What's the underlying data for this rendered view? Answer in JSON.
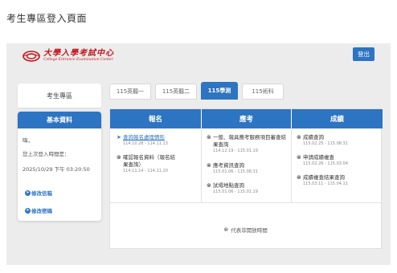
{
  "page": {
    "title": "考生專區登入頁面"
  },
  "header": {
    "logo_main": "大學入學考試中心",
    "logo_sub": "College Entrance Examination Center",
    "logout_label": "登出"
  },
  "sidebar": {
    "heading": "考生專區",
    "card_title": "基本資料",
    "greeting": "嗨，",
    "last_login_label": "您上次登入時間是：",
    "last_login_value": "2025/10/29 下午 03:20:50",
    "links": [
      {
        "label": "修改信箱",
        "icon": "arrow-circle-right-icon"
      },
      {
        "label": "修改密碼",
        "icon": "arrow-circle-right-icon"
      }
    ]
  },
  "tabs": [
    {
      "label": "115英聽一",
      "active": false
    },
    {
      "label": "115英聽二",
      "active": false
    },
    {
      "label": "115學測",
      "active": true
    },
    {
      "label": "115術科",
      "active": false
    }
  ],
  "columns": [
    {
      "title": "報名",
      "items": [
        {
          "text": "查詢報名處理情形",
          "date": "114.10.28 - 114.11.13",
          "icon": "arrow-circle-right-icon",
          "link": true
        },
        {
          "text": "確認報名資料（報名結果查詢）",
          "date": "114.11.14 - 114.11.20",
          "icon": "x-circle-icon",
          "link": false
        }
      ]
    },
    {
      "title": "應考",
      "items": [
        {
          "text": "一般、報具應考服務項目審查結果查詢",
          "date": "114.12.19 - 115.01.19",
          "icon": "x-circle-icon",
          "link": false
        },
        {
          "text": "應考資訊查詢",
          "date": "115.01.06 - 115.08.31",
          "icon": "x-circle-icon",
          "link": false
        },
        {
          "text": "試場地點查詢",
          "date": "115.01.06 - 115.01.19",
          "icon": "x-circle-icon",
          "link": false
        }
      ]
    },
    {
      "title": "成績",
      "items": [
        {
          "text": "成績查詢",
          "date": "115.02.25 - 115.08.31",
          "icon": "x-circle-icon",
          "link": false
        },
        {
          "text": "申請成績複查",
          "date": "115.02.26 - 115.03.04",
          "icon": "x-circle-icon",
          "link": false
        },
        {
          "text": "成績複查結果查詢",
          "date": "115.03.11 - 115.04.11",
          "icon": "x-circle-icon",
          "link": false
        }
      ]
    }
  ],
  "legend": {
    "text": "代表非開放時間",
    "icon": "x-circle-icon"
  },
  "colors": {
    "accent": "#2d74c2",
    "brand_red": "#c4151c",
    "panel_bg": "#ececec"
  }
}
